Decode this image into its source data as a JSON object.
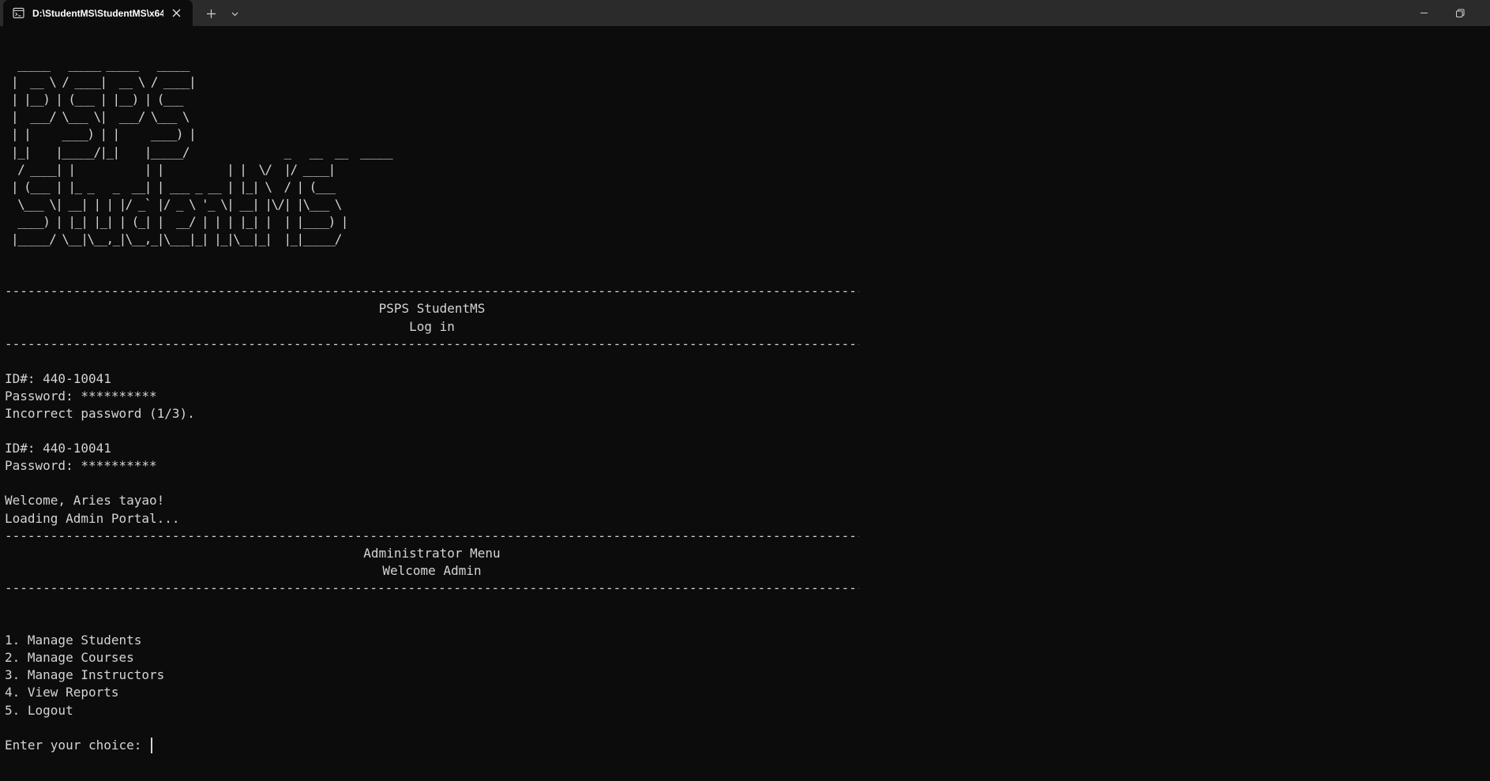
{
  "tab": {
    "title": "D:\\StudentMS\\StudentMS\\x64",
    "icon": "terminal-icon"
  },
  "window_controls": {
    "minimize_icon": "minimize-icon",
    "restore_icon": "restore-icon"
  },
  "ascii_banner": [
    "  _____   _____ _____   _____ ",
    " |  __ \\ / ____|  __ \\ / ____|",
    " | |__) | (___ | |__) | (___  ",
    " |  ___/ \\___ \\|  ___/ \\___ \\ ",
    " | |     ____) | |     ____) |",
    " |_|    |_____/|_|    |_____/               _   __  __  _____ ",
    "  / ____| |           | |          | |  \\/  |/ ____|",
    " | (___ | |_ _   _  __| | ___ _ __ | |_| \\  / | (___  ",
    "  \\___ \\| __| | | |/ _` |/ _ \\ '_ \\| __| |\\/| |\\___ \\ ",
    "  ____) | |_| |_| | (_| |  __/ | | | |_| |  | |____) |",
    " |_____/ \\__|\\__,_|\\__,_|\\___|_| |_|\\__|_|  |_|_____/ "
  ],
  "divider": "--------------------------------------------------------------------------------------------------------------------------------------------------------------------------------------------------------------------------------",
  "login_header": {
    "title": "PSPS StudentMS",
    "subtitle": "Log in"
  },
  "login_attempts": [
    {
      "id_line": "ID#: 440-10041",
      "password_line": "Password: **********",
      "result": "Incorrect password (1/3)."
    },
    {
      "id_line": "ID#: 440-10041",
      "password_line": "Password: **********"
    }
  ],
  "welcome_message": "Welcome, Aries tayao!",
  "loading_message": "Loading Admin Portal...",
  "admin_header": {
    "title": "Administrator Menu",
    "subtitle": "Welcome Admin"
  },
  "menu": [
    "1. Manage Students",
    "2. Manage Courses",
    "3. Manage Instructors",
    "4. View Reports",
    "5. Logout"
  ],
  "prompt": "Enter your choice: "
}
